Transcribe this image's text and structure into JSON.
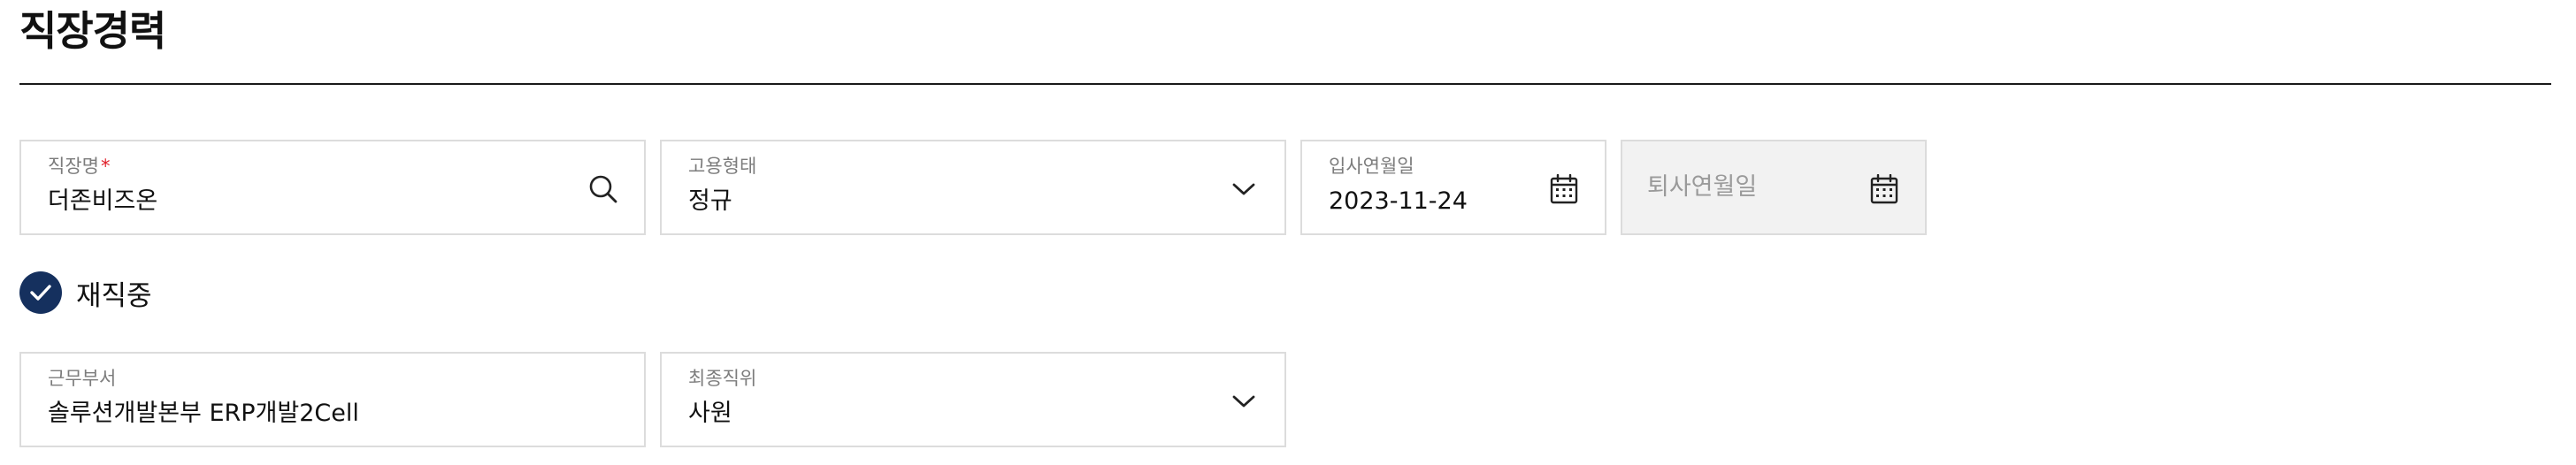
{
  "section": {
    "title": "직장경력"
  },
  "fields": {
    "company": {
      "label": "직장명",
      "required_mark": "*",
      "value": "더존비즈온"
    },
    "employment_type": {
      "label": "고용형태",
      "value": "정규"
    },
    "join_date": {
      "label": "입사연월일",
      "value": "2023-11-24"
    },
    "leave_date": {
      "placeholder": "퇴사연월일"
    },
    "department": {
      "label": "근무부서",
      "value": "솔루션개발본부 ERP개발2Cell"
    },
    "final_position": {
      "label": "최종직위",
      "value": "사원"
    }
  },
  "currently_employed": {
    "label": "재직중",
    "checked": true
  },
  "colors": {
    "accent": "#15305e",
    "required": "#e0202a",
    "border": "#dcdcdc",
    "disabled_bg": "#f2f2f2"
  },
  "icons": {
    "search": "search-icon",
    "dropdown": "chevron-down-icon",
    "calendar": "calendar-icon",
    "check": "check-icon"
  }
}
